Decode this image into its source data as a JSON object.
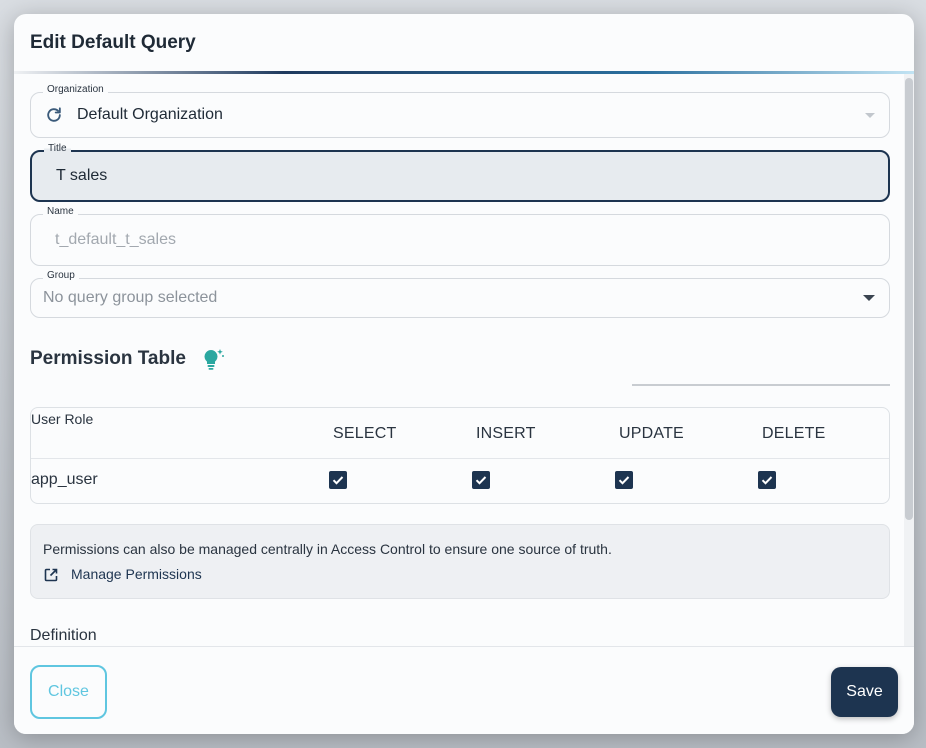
{
  "dialog": {
    "title": "Edit Default Query"
  },
  "form": {
    "organization": {
      "label": "Organization",
      "value": "Default Organization",
      "icon": "refresh-icon"
    },
    "title": {
      "label": "Title",
      "value": "T sales"
    },
    "name": {
      "label": "Name",
      "placeholder": "t_default_t_sales"
    },
    "group": {
      "label": "Group",
      "placeholder": "No query group selected"
    }
  },
  "permissions": {
    "heading": "Permission Table",
    "icon": "lightbulb-sparkle-icon",
    "columns": {
      "role": "User Role",
      "select": "SELECT",
      "insert": "INSERT",
      "update": "UPDATE",
      "delete": "DELETE"
    },
    "rows": [
      {
        "role": "app_user",
        "select": true,
        "insert": true,
        "update": true,
        "delete": true
      }
    ]
  },
  "info": {
    "text": "Permissions can also be managed centrally in Access Control to ensure one source of truth.",
    "link_label": "Manage Permissions",
    "link_icon": "external-link-icon"
  },
  "definition": {
    "label": "Definition"
  },
  "footer": {
    "close_label": "Close",
    "save_label": "Save"
  },
  "colors": {
    "primary": "#1d3450",
    "accent": "#5fc6e0",
    "bulb": "#2aa7a0"
  }
}
